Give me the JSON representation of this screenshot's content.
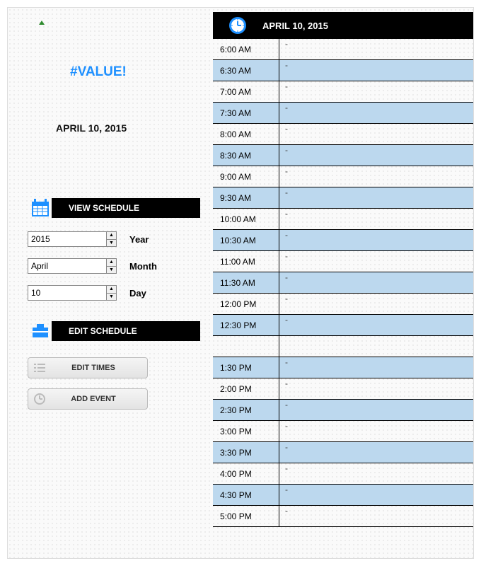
{
  "left": {
    "hash_value": "#VALUE!",
    "current_date": "APRIL 10, 2015",
    "view_section_label": "VIEW SCHEDULE",
    "edit_section_label": "EDIT SCHEDULE",
    "fields": {
      "year": {
        "value": "2015",
        "label": "Year"
      },
      "month": {
        "value": "April",
        "label": "Month"
      },
      "day": {
        "value": "10",
        "label": "Day"
      }
    },
    "buttons": {
      "edit_times": "EDIT TIMES",
      "add_event": "ADD EVENT"
    }
  },
  "schedule": {
    "header_date": "APRIL 10, 2015",
    "rows": [
      {
        "time": "6:00 AM",
        "event": "-",
        "shaded": false
      },
      {
        "time": "6:30 AM",
        "event": "-",
        "shaded": true
      },
      {
        "time": "7:00 AM",
        "event": "-",
        "shaded": false
      },
      {
        "time": "7:30 AM",
        "event": "-",
        "shaded": true
      },
      {
        "time": "8:00 AM",
        "event": "-",
        "shaded": false
      },
      {
        "time": "8:30 AM",
        "event": "-",
        "shaded": true
      },
      {
        "time": "9:00 AM",
        "event": "-",
        "shaded": false
      },
      {
        "time": "9:30 AM",
        "event": "-",
        "shaded": true
      },
      {
        "time": "10:00 AM",
        "event": "-",
        "shaded": false
      },
      {
        "time": "10:30 AM",
        "event": "-",
        "shaded": true
      },
      {
        "time": "11:00 AM",
        "event": "-",
        "shaded": false
      },
      {
        "time": "11:30 AM",
        "event": "-",
        "shaded": true
      },
      {
        "time": "12:00 PM",
        "event": "-",
        "shaded": false
      },
      {
        "time": "12:30 PM",
        "event": "-",
        "shaded": true
      },
      {
        "time": "",
        "event": "",
        "shaded": false
      },
      {
        "time": "1:30 PM",
        "event": "-",
        "shaded": true
      },
      {
        "time": "2:00 PM",
        "event": "-",
        "shaded": false
      },
      {
        "time": "2:30 PM",
        "event": "-",
        "shaded": true
      },
      {
        "time": "3:00 PM",
        "event": "-",
        "shaded": false
      },
      {
        "time": "3:30 PM",
        "event": "-",
        "shaded": true
      },
      {
        "time": "4:00 PM",
        "event": "-",
        "shaded": false
      },
      {
        "time": "4:30 PM",
        "event": "-",
        "shaded": true
      },
      {
        "time": "5:00 PM",
        "event": "-",
        "shaded": false
      }
    ]
  }
}
